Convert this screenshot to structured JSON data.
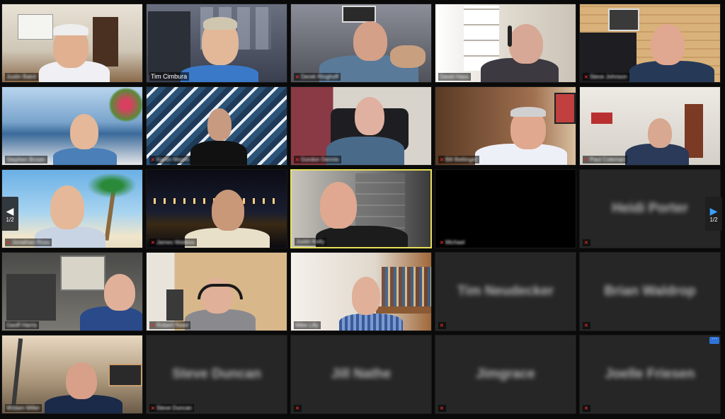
{
  "meeting": {
    "pager_left_label": "1/2",
    "pager_right_label": "1/2",
    "pager_left_icon": "chevron-left-icon",
    "pager_right_icon": "chevron-right-icon",
    "more_icon": "more-options-icon"
  },
  "tiles": [
    {
      "name": "Justin Baird",
      "muted": false,
      "blur_name": true
    },
    {
      "name": "Tim Cimbura",
      "muted": false,
      "blur_name": false
    },
    {
      "name": "Derek Ringhoff",
      "muted": true,
      "blur_name": true
    },
    {
      "name": "David Hass",
      "muted": false,
      "blur_name": true
    },
    {
      "name": "Steve Johnson",
      "muted": true,
      "blur_name": true
    },
    {
      "name": "Stephen Brown",
      "muted": false,
      "blur_name": true
    },
    {
      "name": "Karen Moore",
      "muted": true,
      "blur_name": true
    },
    {
      "name": "Gordon Dennis",
      "muted": true,
      "blur_name": true
    },
    {
      "name": "Bill Bettinger",
      "muted": true,
      "blur_name": true
    },
    {
      "name": "Paul Coleman",
      "muted": true,
      "blur_name": true
    },
    {
      "name": "Jonathan Ross",
      "muted": true,
      "blur_name": true
    },
    {
      "name": "James Watkins",
      "muted": true,
      "blur_name": true
    },
    {
      "name": "Justin Kelly",
      "muted": false,
      "blur_name": true
    },
    {
      "name": "Michael",
      "muted": true,
      "blur_name": true
    },
    {
      "name": "Heidi Porter",
      "muted": true,
      "blur_name": true
    },
    {
      "name": "Geoff Harris",
      "muted": false,
      "blur_name": true
    },
    {
      "name": "Robert Reed",
      "muted": true,
      "blur_name": true
    },
    {
      "name": "Mike Lilly",
      "muted": false,
      "blur_name": true
    },
    {
      "name": "Tim Neudecker",
      "muted": true,
      "blur_name": true
    },
    {
      "name": "Brian Waldrop",
      "muted": true,
      "blur_name": true
    },
    {
      "name": "William Miller",
      "muted": true,
      "blur_name": true
    },
    {
      "name": "Steve Duncan",
      "muted": true,
      "blur_name": true
    },
    {
      "name": "Jill Nathe",
      "muted": true,
      "blur_name": true
    },
    {
      "name": "Jimgrace",
      "muted": true,
      "blur_name": true
    },
    {
      "name": "Joelle Friesen",
      "muted": true,
      "blur_name": true
    }
  ],
  "center_names": {
    "heidi": "Heidi Porter",
    "tim_n": "Tim Neudecker",
    "brian": "Brian Waldrop",
    "steve": "Steve Duncan",
    "jill": "Jill Nathe",
    "jim": "Jimgrace",
    "joelle": "Joelle Friesen"
  },
  "colors": {
    "active_speaker_border": "#e6e05a",
    "muted_icon": "#e02b2b",
    "pager_accent": "#3aa0ff"
  }
}
